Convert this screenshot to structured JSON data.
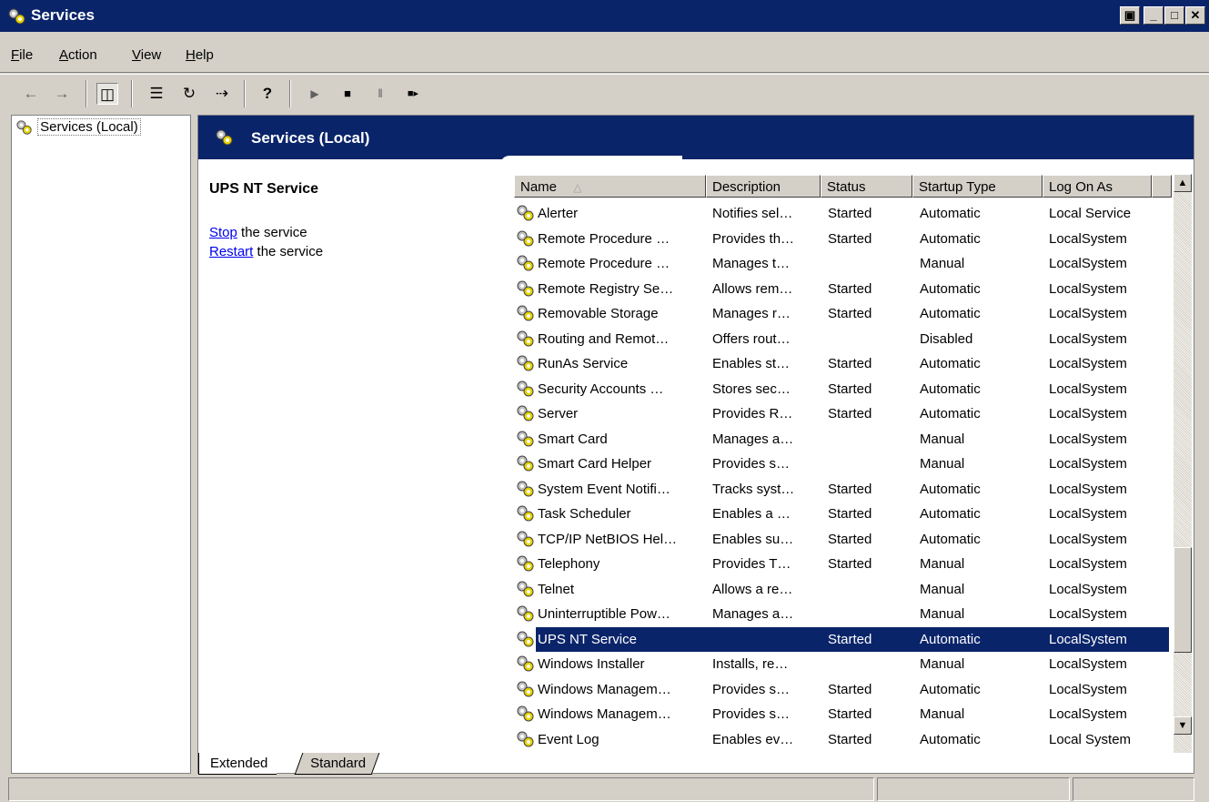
{
  "window": {
    "title": "Services",
    "icon": "services-gear-icon",
    "buttons": [
      "restore-icon",
      "minimize-icon",
      "maximize-icon",
      "close-icon"
    ]
  },
  "menu": [
    {
      "label": "File",
      "accel": "F"
    },
    {
      "label": "Action",
      "accel": "A"
    },
    {
      "label": "View",
      "accel": "V"
    },
    {
      "label": "Help",
      "accel": "H"
    }
  ],
  "toolbar": {
    "back_glyph": "←",
    "forward_glyph": "→",
    "show_hide_glyph": "◫",
    "properties_glyph": "☰",
    "refresh_glyph": "↻",
    "export_glyph": "⇢",
    "help_glyph": "?",
    "start_glyph": "▶",
    "stop_glyph": "■",
    "pause_glyph": "‖",
    "restart_glyph": "■▸"
  },
  "tree": {
    "item": "Services (Local)"
  },
  "header": {
    "title": "Services (Local)"
  },
  "detail": {
    "service_name": "UPS NT Service",
    "stop_link": "Stop",
    "stop_suffix": " the service",
    "restart_link": "Restart",
    "restart_suffix": " the service"
  },
  "columns": {
    "name": "Name",
    "description": "Description",
    "status": "Status",
    "startup": "Startup Type",
    "logon": "Log On As",
    "sort_glyph": "△"
  },
  "services": [
    {
      "name": "Alerter",
      "desc": "Notifies sel…",
      "status": "Started",
      "startup": "Automatic",
      "logon": "Local Service"
    },
    {
      "name": "Remote Procedure …",
      "desc": "Provides th…",
      "status": "Started",
      "startup": "Automatic",
      "logon": "LocalSystem"
    },
    {
      "name": "Remote Procedure …",
      "desc": "Manages t…",
      "status": "",
      "startup": "Manual",
      "logon": "LocalSystem"
    },
    {
      "name": "Remote Registry Se…",
      "desc": "Allows rem…",
      "status": "Started",
      "startup": "Automatic",
      "logon": "LocalSystem"
    },
    {
      "name": "Removable Storage",
      "desc": "Manages r…",
      "status": "Started",
      "startup": "Automatic",
      "logon": "LocalSystem"
    },
    {
      "name": "Routing and Remot…",
      "desc": "Offers rout…",
      "status": "",
      "startup": "Disabled",
      "logon": "LocalSystem"
    },
    {
      "name": "RunAs Service",
      "desc": "Enables st…",
      "status": "Started",
      "startup": "Automatic",
      "logon": "LocalSystem"
    },
    {
      "name": "Security Accounts …",
      "desc": "Stores sec…",
      "status": "Started",
      "startup": "Automatic",
      "logon": "LocalSystem"
    },
    {
      "name": "Server",
      "desc": "Provides R…",
      "status": "Started",
      "startup": "Automatic",
      "logon": "LocalSystem"
    },
    {
      "name": "Smart Card",
      "desc": "Manages a…",
      "status": "",
      "startup": "Manual",
      "logon": "LocalSystem"
    },
    {
      "name": "Smart Card Helper",
      "desc": "Provides s…",
      "status": "",
      "startup": "Manual",
      "logon": "LocalSystem"
    },
    {
      "name": "System Event Notifi…",
      "desc": "Tracks syst…",
      "status": "Started",
      "startup": "Automatic",
      "logon": "LocalSystem"
    },
    {
      "name": "Task Scheduler",
      "desc": "Enables a …",
      "status": "Started",
      "startup": "Automatic",
      "logon": "LocalSystem"
    },
    {
      "name": "TCP/IP NetBIOS Hel…",
      "desc": "Enables su…",
      "status": "Started",
      "startup": "Automatic",
      "logon": "LocalSystem"
    },
    {
      "name": "Telephony",
      "desc": "Provides T…",
      "status": "Started",
      "startup": "Manual",
      "logon": "LocalSystem"
    },
    {
      "name": "Telnet",
      "desc": "Allows a re…",
      "status": "",
      "startup": "Manual",
      "logon": "LocalSystem"
    },
    {
      "name": "Uninterruptible Pow…",
      "desc": "Manages a…",
      "status": "",
      "startup": "Manual",
      "logon": "LocalSystem"
    },
    {
      "name": "UPS NT Service",
      "desc": "",
      "status": "Started",
      "startup": "Automatic",
      "logon": "LocalSystem",
      "selected": true
    },
    {
      "name": "Windows Installer",
      "desc": "Installs, re…",
      "status": "",
      "startup": "Manual",
      "logon": "LocalSystem"
    },
    {
      "name": "Windows Managem…",
      "desc": "Provides s…",
      "status": "Started",
      "startup": "Automatic",
      "logon": "LocalSystem"
    },
    {
      "name": "Windows Managem…",
      "desc": "Provides s…",
      "status": "Started",
      "startup": "Manual",
      "logon": "LocalSystem"
    },
    {
      "name": "Event Log",
      "desc": "Enables ev…",
      "status": "Started",
      "startup": "Automatic",
      "logon": "Local System"
    }
  ],
  "scrollbar": {
    "up_glyph": "▲",
    "down_glyph": "▼"
  },
  "tabs": {
    "extended": "Extended",
    "standard": "Standard"
  },
  "colors": {
    "titlebar": "#0a246a",
    "face": "#d4d0c8",
    "selection": "#0a246a",
    "link": "#0000ee"
  }
}
